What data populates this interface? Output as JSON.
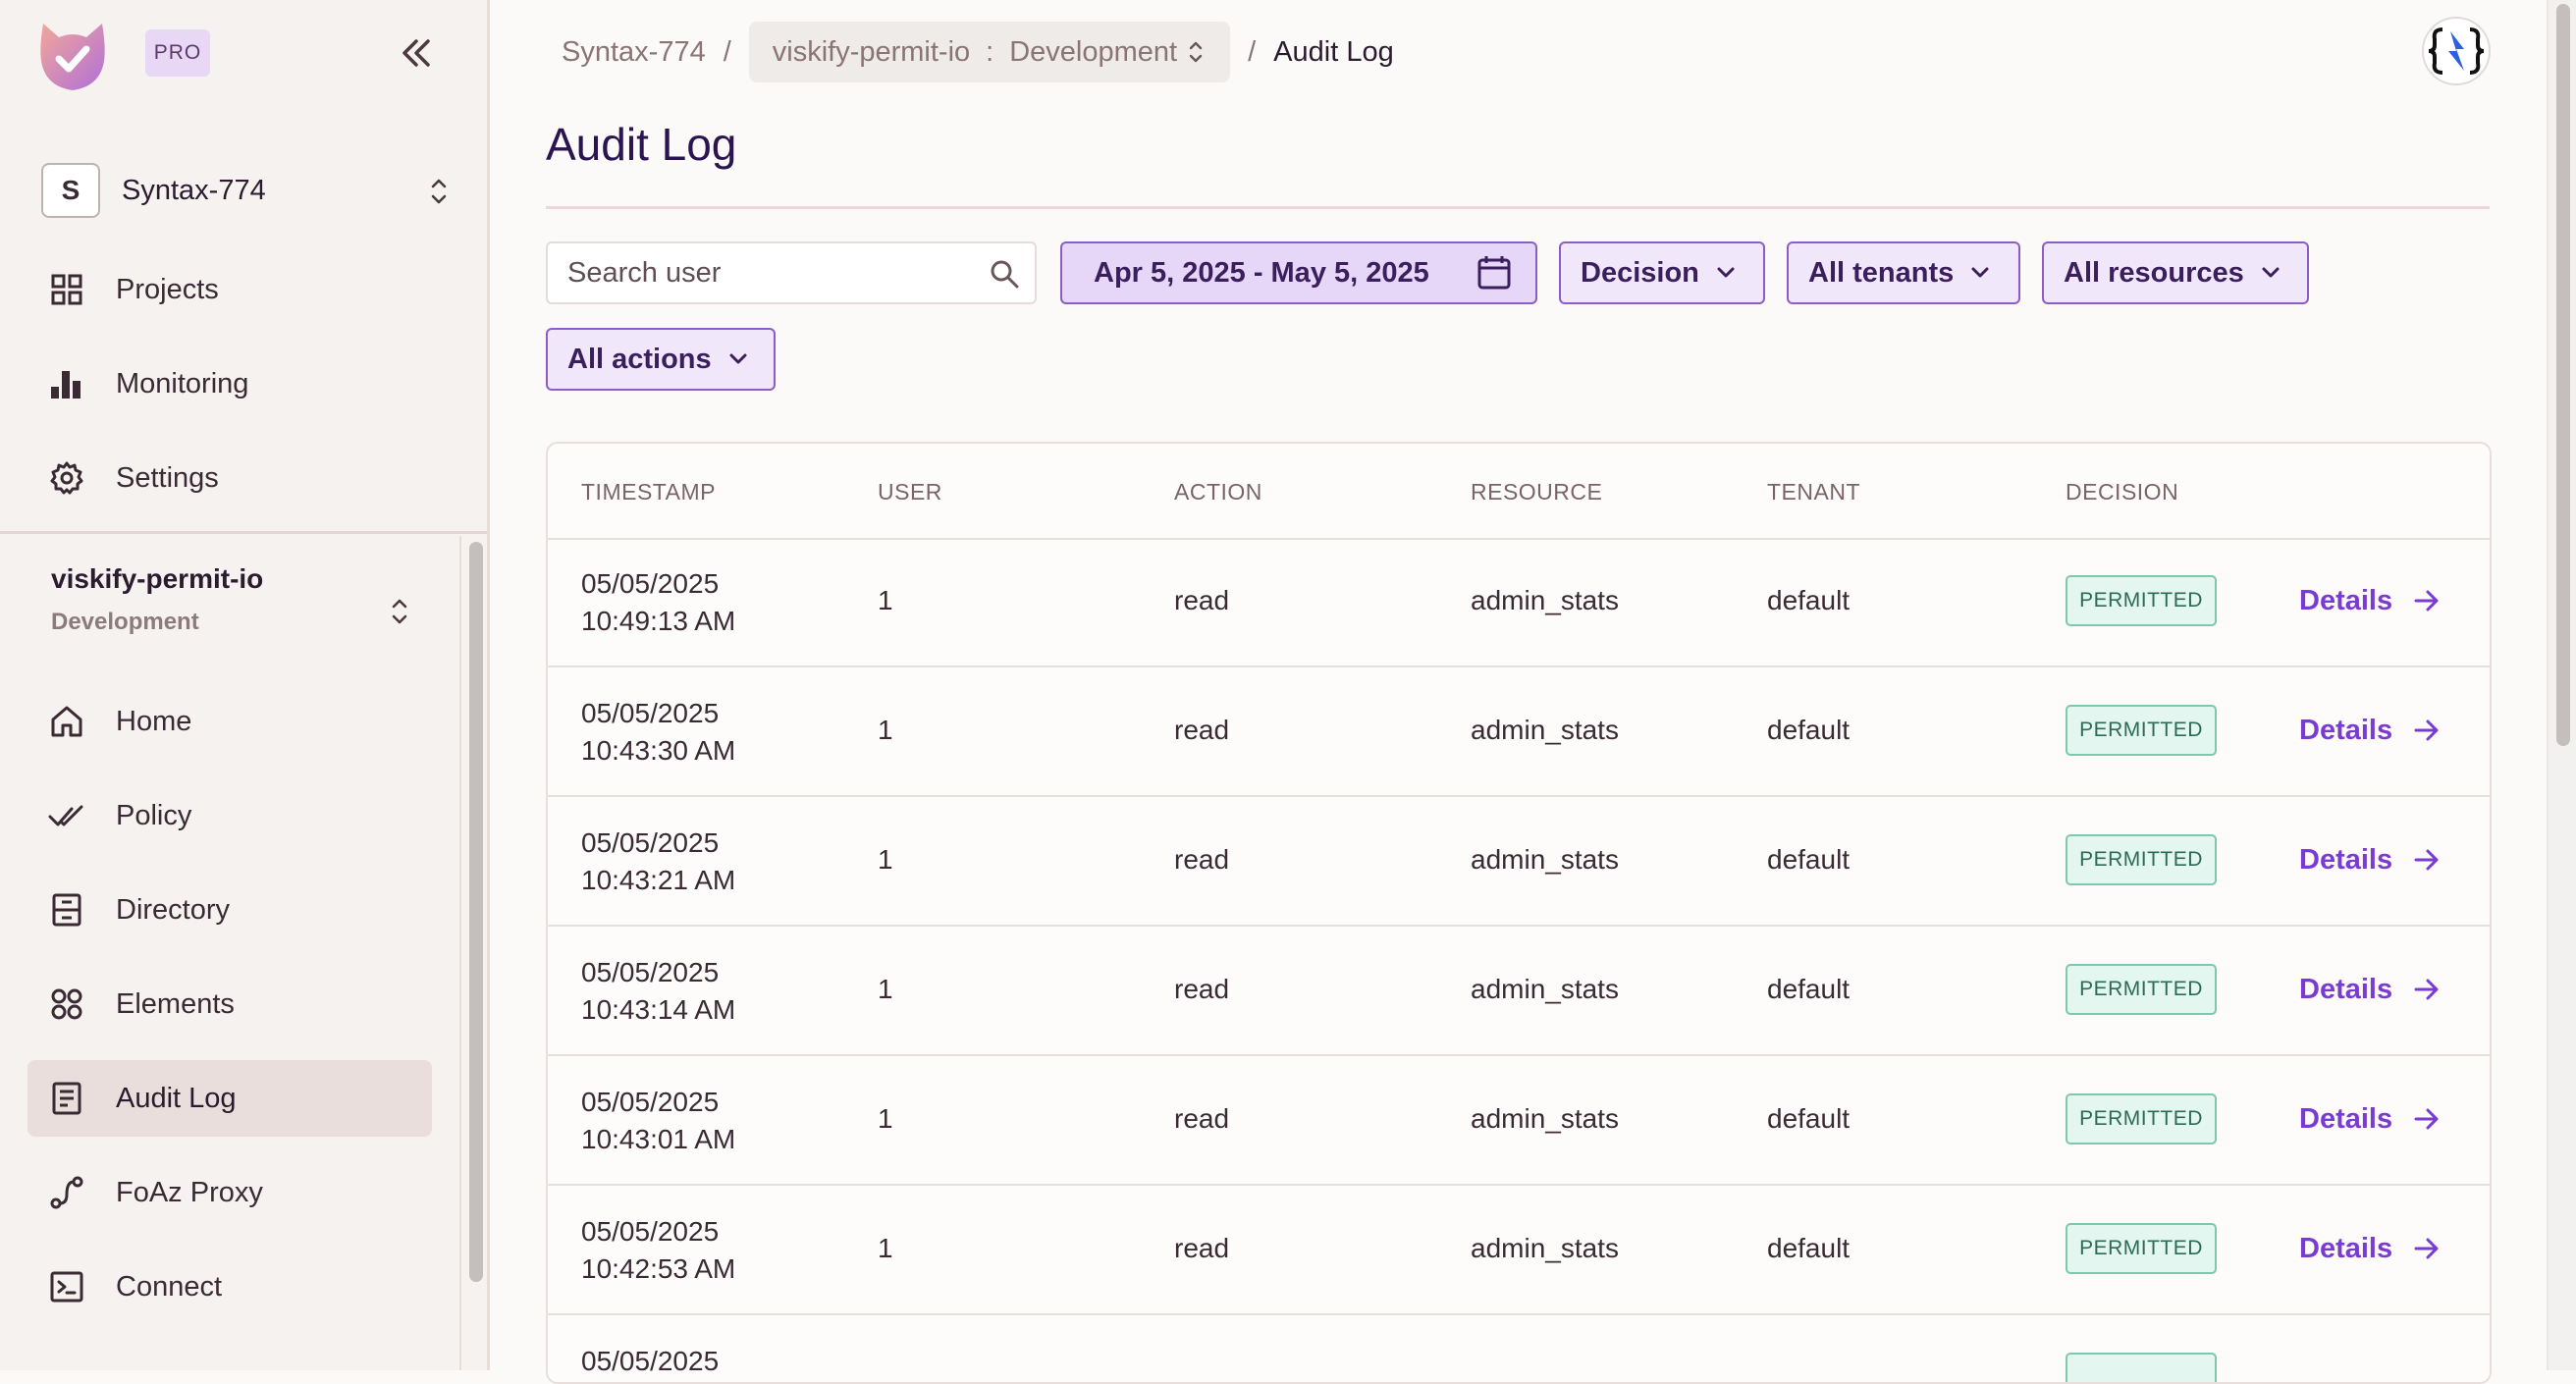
{
  "sidebar": {
    "pro_label": "PRO",
    "org": {
      "avatar_letter": "S",
      "name": "Syntax-774"
    },
    "top_items": [
      {
        "label": "Projects",
        "icon": "grid-icon"
      },
      {
        "label": "Monitoring",
        "icon": "bar-chart-icon"
      },
      {
        "label": "Settings",
        "icon": "gear-icon"
      }
    ],
    "env": {
      "name": "viskify-permit-io",
      "sub": "Development"
    },
    "items": [
      {
        "label": "Home",
        "icon": "home-icon"
      },
      {
        "label": "Policy",
        "icon": "double-check-icon"
      },
      {
        "label": "Directory",
        "icon": "directory-icon"
      },
      {
        "label": "Elements",
        "icon": "elements-icon"
      },
      {
        "label": "Audit Log",
        "icon": "document-icon",
        "active": true
      },
      {
        "label": "FoAz Proxy",
        "icon": "route-icon"
      },
      {
        "label": "Connect",
        "icon": "terminal-icon"
      }
    ]
  },
  "breadcrumb": {
    "org": "Syntax-774",
    "sep": "/",
    "project": "viskify-permit-io",
    "colon": ":",
    "env": "Development",
    "current": "Audit Log"
  },
  "page": {
    "title": "Audit Log"
  },
  "filters": {
    "search_placeholder": "Search user",
    "date_range": "Apr 5, 2025 - May 5, 2025",
    "decision": "Decision",
    "tenants": "All tenants",
    "resources": "All resources",
    "actions": "All actions"
  },
  "table": {
    "headers": [
      "TIMESTAMP",
      "USER",
      "ACTION",
      "RESOURCE",
      "TENANT",
      "DECISION"
    ],
    "details_label": "Details",
    "rows": [
      {
        "date": "05/05/2025",
        "time": "10:49:13 AM",
        "user": "1",
        "action": "read",
        "resource": "admin_stats",
        "tenant": "default",
        "decision": "PERMITTED"
      },
      {
        "date": "05/05/2025",
        "time": "10:43:30 AM",
        "user": "1",
        "action": "read",
        "resource": "admin_stats",
        "tenant": "default",
        "decision": "PERMITTED"
      },
      {
        "date": "05/05/2025",
        "time": "10:43:21 AM",
        "user": "1",
        "action": "read",
        "resource": "admin_stats",
        "tenant": "default",
        "decision": "PERMITTED"
      },
      {
        "date": "05/05/2025",
        "time": "10:43:14 AM",
        "user": "1",
        "action": "read",
        "resource": "admin_stats",
        "tenant": "default",
        "decision": "PERMITTED"
      },
      {
        "date": "05/05/2025",
        "time": "10:43:01 AM",
        "user": "1",
        "action": "read",
        "resource": "admin_stats",
        "tenant": "default",
        "decision": "PERMITTED"
      },
      {
        "date": "05/05/2025",
        "time": "10:42:53 AM",
        "user": "1",
        "action": "read",
        "resource": "admin_stats",
        "tenant": "default",
        "decision": "PERMITTED"
      },
      {
        "date": "05/05/2025",
        "time": "",
        "user": "",
        "action": "",
        "resource": "",
        "tenant": "",
        "decision": ""
      }
    ]
  },
  "colors": {
    "accent": "#7a3bd1",
    "permitted_bg": "#e3f6ef",
    "permitted_border": "#7ec8b0",
    "title": "#2a1550"
  }
}
